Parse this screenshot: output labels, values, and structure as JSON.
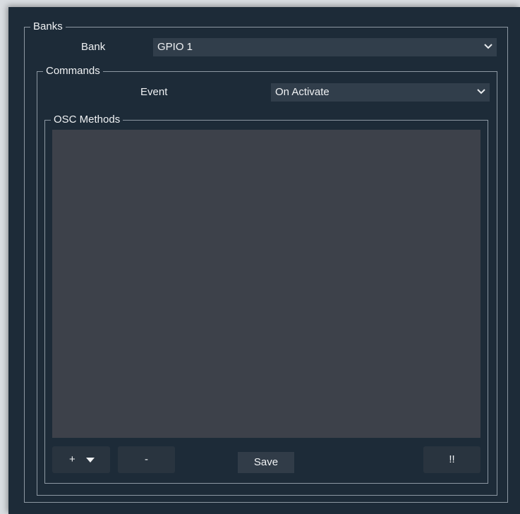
{
  "banks": {
    "group_title": "Banks",
    "bank_label": "Bank",
    "bank_value": "GPIO 1",
    "commands": {
      "group_title": "Commands",
      "event_label": "Event",
      "event_value": "On Activate",
      "osc_methods": {
        "group_title": "OSC Methods",
        "items": []
      }
    }
  },
  "buttons": {
    "add": "+",
    "remove": "-",
    "save": "Save",
    "warning": "!!"
  },
  "icons": {
    "dropdown": "chevron-down-icon",
    "add_menu": "caret-down-icon"
  },
  "colors": {
    "background": "#1d2b38",
    "field": "#313e4b",
    "list": "#3d414a",
    "border": "#8d98a3",
    "text": "#f0f2f4"
  }
}
